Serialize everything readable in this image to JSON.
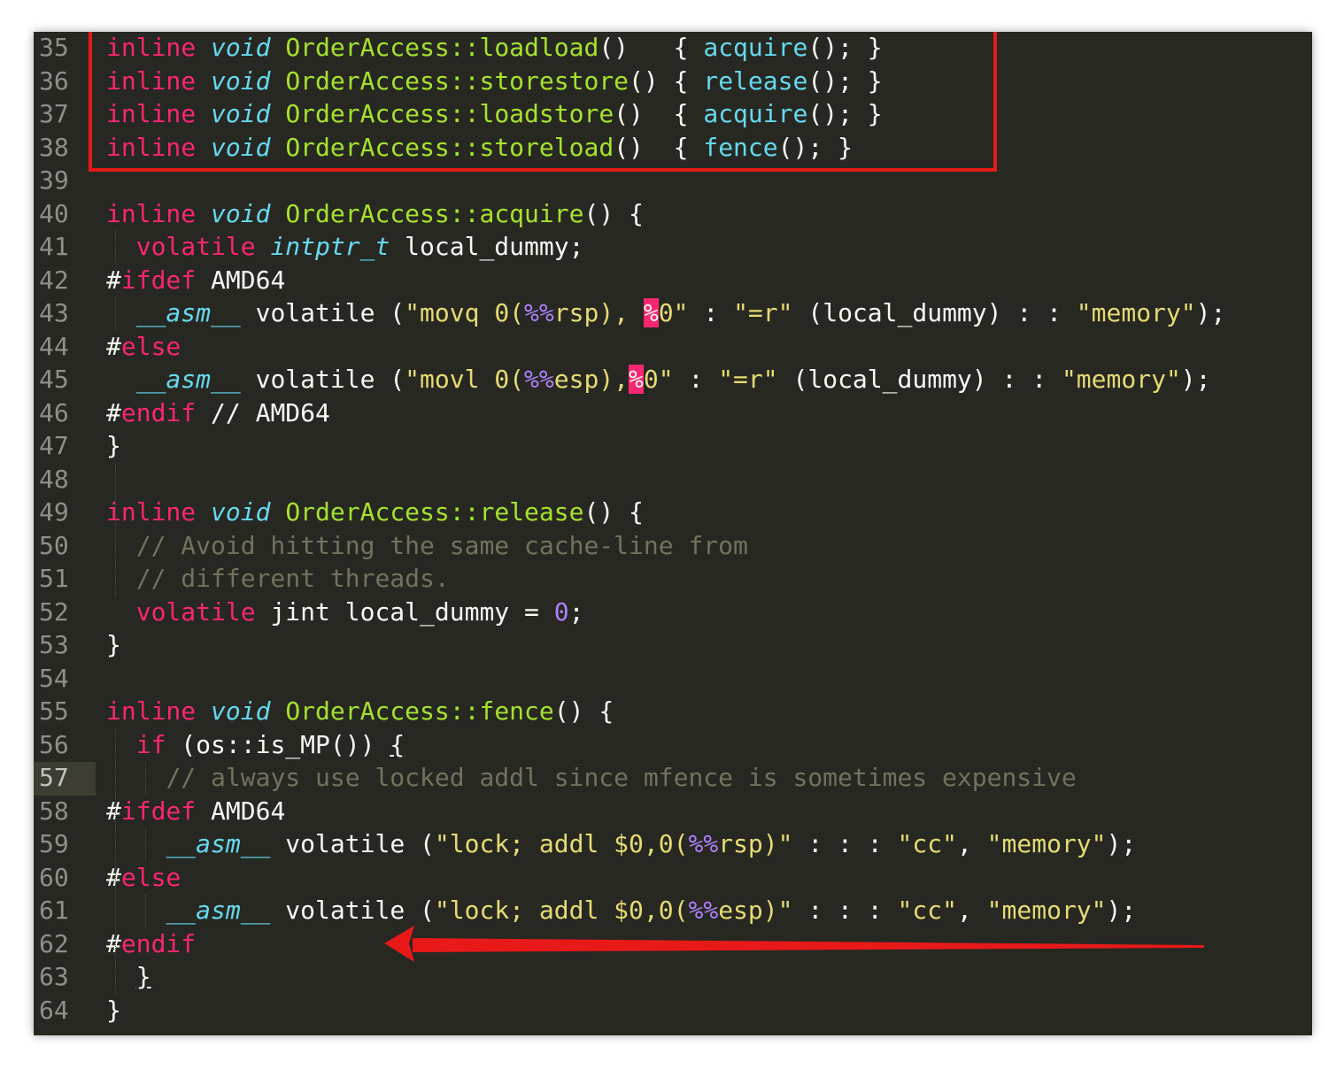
{
  "editor": {
    "current_line": "57",
    "lines": [
      {
        "n": "35",
        "tokens": [
          [
            "kw",
            "inline"
          ],
          [
            "p",
            " "
          ],
          [
            "ty",
            "void"
          ],
          [
            "p",
            " "
          ],
          [
            "fn",
            "OrderAccess::loadload"
          ],
          [
            "p",
            "()   { "
          ],
          [
            "call",
            "acquire"
          ],
          [
            "p",
            "(); }"
          ]
        ]
      },
      {
        "n": "36",
        "tokens": [
          [
            "kw",
            "inline"
          ],
          [
            "p",
            " "
          ],
          [
            "ty",
            "void"
          ],
          [
            "p",
            " "
          ],
          [
            "fn",
            "OrderAccess::storestore"
          ],
          [
            "p",
            "() { "
          ],
          [
            "call",
            "release"
          ],
          [
            "p",
            "(); }"
          ]
        ]
      },
      {
        "n": "37",
        "tokens": [
          [
            "kw",
            "inline"
          ],
          [
            "p",
            " "
          ],
          [
            "ty",
            "void"
          ],
          [
            "p",
            " "
          ],
          [
            "fn",
            "OrderAccess::loadstore"
          ],
          [
            "p",
            "()  { "
          ],
          [
            "call",
            "acquire"
          ],
          [
            "p",
            "(); }"
          ]
        ]
      },
      {
        "n": "38",
        "tokens": [
          [
            "kw",
            "inline"
          ],
          [
            "p",
            " "
          ],
          [
            "ty",
            "void"
          ],
          [
            "p",
            " "
          ],
          [
            "fn",
            "OrderAccess::storeload"
          ],
          [
            "p",
            "()  { "
          ],
          [
            "call",
            "fence"
          ],
          [
            "p",
            "(); }"
          ]
        ]
      },
      {
        "n": "39",
        "tokens": []
      },
      {
        "n": "40",
        "tokens": [
          [
            "kw",
            "inline"
          ],
          [
            "p",
            " "
          ],
          [
            "ty",
            "void"
          ],
          [
            "p",
            " "
          ],
          [
            "fn",
            "OrderAccess::acquire"
          ],
          [
            "p",
            "() {"
          ]
        ]
      },
      {
        "n": "41",
        "tokens": [
          [
            "p",
            "  "
          ],
          [
            "kw",
            "volatile"
          ],
          [
            "p",
            " "
          ],
          [
            "ty",
            "intptr_t"
          ],
          [
            "p",
            " local_dummy;"
          ]
        ]
      },
      {
        "n": "42",
        "tokens": [
          [
            "p",
            "#"
          ],
          [
            "kw",
            "ifdef"
          ],
          [
            "p",
            " AMD64"
          ]
        ]
      },
      {
        "n": "43",
        "tokens": [
          [
            "p",
            "  "
          ],
          [
            "ty",
            "__asm__"
          ],
          [
            "p",
            " volatile ("
          ],
          [
            "str",
            "\"movq 0("
          ],
          [
            "fmt",
            "%%"
          ],
          [
            "str",
            "rsp), "
          ],
          [
            "err",
            "%"
          ],
          [
            "str",
            "0\""
          ],
          [
            "p",
            " : "
          ],
          [
            "str",
            "\"=r\""
          ],
          [
            "p",
            " (local_dummy) : : "
          ],
          [
            "str",
            "\"memory\""
          ],
          [
            "p",
            ");"
          ]
        ]
      },
      {
        "n": "44",
        "tokens": [
          [
            "p",
            "#"
          ],
          [
            "kw",
            "else"
          ]
        ]
      },
      {
        "n": "45",
        "tokens": [
          [
            "p",
            "  "
          ],
          [
            "ty",
            "__asm__"
          ],
          [
            "p",
            " volatile ("
          ],
          [
            "str",
            "\"movl 0("
          ],
          [
            "fmt",
            "%%"
          ],
          [
            "str",
            "esp),"
          ],
          [
            "err",
            "%"
          ],
          [
            "str",
            "0\""
          ],
          [
            "p",
            " : "
          ],
          [
            "str",
            "\"=r\""
          ],
          [
            "p",
            " (local_dummy) : : "
          ],
          [
            "str",
            "\"memory\""
          ],
          [
            "p",
            ");"
          ]
        ]
      },
      {
        "n": "46",
        "tokens": [
          [
            "p",
            "#"
          ],
          [
            "kw",
            "endif"
          ],
          [
            "p",
            " // AMD64"
          ]
        ]
      },
      {
        "n": "47",
        "tokens": [
          [
            "p",
            "}"
          ]
        ]
      },
      {
        "n": "48",
        "tokens": []
      },
      {
        "n": "49",
        "tokens": [
          [
            "kw",
            "inline"
          ],
          [
            "p",
            " "
          ],
          [
            "ty",
            "void"
          ],
          [
            "p",
            " "
          ],
          [
            "fn",
            "OrderAccess::release"
          ],
          [
            "p",
            "() {"
          ]
        ]
      },
      {
        "n": "50",
        "tokens": [
          [
            "p",
            "  "
          ],
          [
            "cm",
            "// Avoid hitting the same cache-line from"
          ]
        ]
      },
      {
        "n": "51",
        "tokens": [
          [
            "p",
            "  "
          ],
          [
            "cm",
            "// different threads."
          ]
        ]
      },
      {
        "n": "52",
        "tokens": [
          [
            "p",
            "  "
          ],
          [
            "kw",
            "volatile"
          ],
          [
            "p",
            " jint local_dummy = "
          ],
          [
            "num",
            "0"
          ],
          [
            "p",
            ";"
          ]
        ]
      },
      {
        "n": "53",
        "tokens": [
          [
            "p",
            "}"
          ]
        ]
      },
      {
        "n": "54",
        "tokens": []
      },
      {
        "n": "55",
        "tokens": [
          [
            "kw",
            "inline"
          ],
          [
            "p",
            " "
          ],
          [
            "ty",
            "void"
          ],
          [
            "p",
            " "
          ],
          [
            "fn",
            "OrderAccess::fence"
          ],
          [
            "p",
            "() {"
          ]
        ]
      },
      {
        "n": "56",
        "tokens": [
          [
            "p",
            "  "
          ],
          [
            "kw",
            "if"
          ],
          [
            "p",
            " (os::is_MP()) "
          ],
          [
            "ul",
            "{"
          ]
        ]
      },
      {
        "n": "57",
        "tokens": [
          [
            "p",
            "    "
          ],
          [
            "cm",
            "// always use locked addl since mfence is sometimes expensive"
          ]
        ]
      },
      {
        "n": "58",
        "tokens": [
          [
            "p",
            "#"
          ],
          [
            "kw",
            "ifdef"
          ],
          [
            "p",
            " AMD64"
          ]
        ]
      },
      {
        "n": "59",
        "tokens": [
          [
            "p",
            "    "
          ],
          [
            "ty",
            "__asm__"
          ],
          [
            "p",
            " volatile ("
          ],
          [
            "str",
            "\"lock; addl $0,0("
          ],
          [
            "fmt",
            "%%"
          ],
          [
            "str",
            "rsp)\""
          ],
          [
            "p",
            " : : : "
          ],
          [
            "str",
            "\"cc\""
          ],
          [
            "p",
            ", "
          ],
          [
            "str",
            "\"memory\""
          ],
          [
            "p",
            ");"
          ]
        ]
      },
      {
        "n": "60",
        "tokens": [
          [
            "p",
            "#"
          ],
          [
            "kw",
            "else"
          ]
        ]
      },
      {
        "n": "61",
        "tokens": [
          [
            "p",
            "    "
          ],
          [
            "ty",
            "__asm__"
          ],
          [
            "p",
            " volatile ("
          ],
          [
            "str",
            "\"lock; addl $0,0("
          ],
          [
            "fmt",
            "%%"
          ],
          [
            "str",
            "esp)\""
          ],
          [
            "p",
            " : : : "
          ],
          [
            "str",
            "\"cc\""
          ],
          [
            "p",
            ", "
          ],
          [
            "str",
            "\"memory\""
          ],
          [
            "p",
            ");"
          ]
        ]
      },
      {
        "n": "62",
        "tokens": [
          [
            "p",
            "#"
          ],
          [
            "kw",
            "endif"
          ]
        ]
      },
      {
        "n": "63",
        "tokens": [
          [
            "p",
            "  "
          ],
          [
            "ul",
            "}"
          ]
        ]
      },
      {
        "n": "64",
        "tokens": [
          [
            "p",
            "}"
          ]
        ]
      }
    ]
  },
  "annotations": {
    "box_color": "#e81919",
    "arrow_color": "#e81919"
  }
}
